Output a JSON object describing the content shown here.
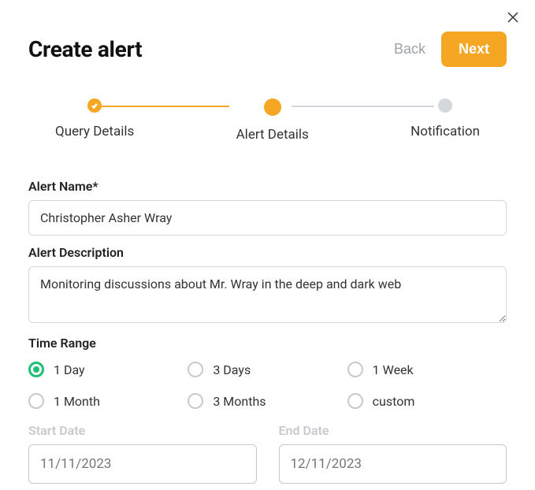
{
  "header": {
    "title": "Create alert",
    "back_label": "Back",
    "next_label": "Next"
  },
  "stepper": {
    "steps": [
      {
        "label": "Query Details",
        "state": "completed"
      },
      {
        "label": "Alert Details",
        "state": "active"
      },
      {
        "label": "Notification",
        "state": "pending"
      }
    ]
  },
  "form": {
    "alert_name": {
      "label": "Alert Name*",
      "value": "Christopher Asher Wray"
    },
    "alert_description": {
      "label": "Alert Description",
      "value": "Monitoring discussions about Mr. Wray in the deep and dark web"
    },
    "time_range": {
      "label": "Time Range",
      "options": [
        {
          "label": "1 Day",
          "selected": true
        },
        {
          "label": "3 Days",
          "selected": false
        },
        {
          "label": "1 Week",
          "selected": false
        },
        {
          "label": "1 Month",
          "selected": false
        },
        {
          "label": "3 Months",
          "selected": false
        },
        {
          "label": "custom",
          "selected": false
        }
      ]
    },
    "start_date": {
      "label": "Start Date",
      "value": "11/11/2023"
    },
    "end_date": {
      "label": "End Date",
      "value": "12/11/2023"
    }
  }
}
